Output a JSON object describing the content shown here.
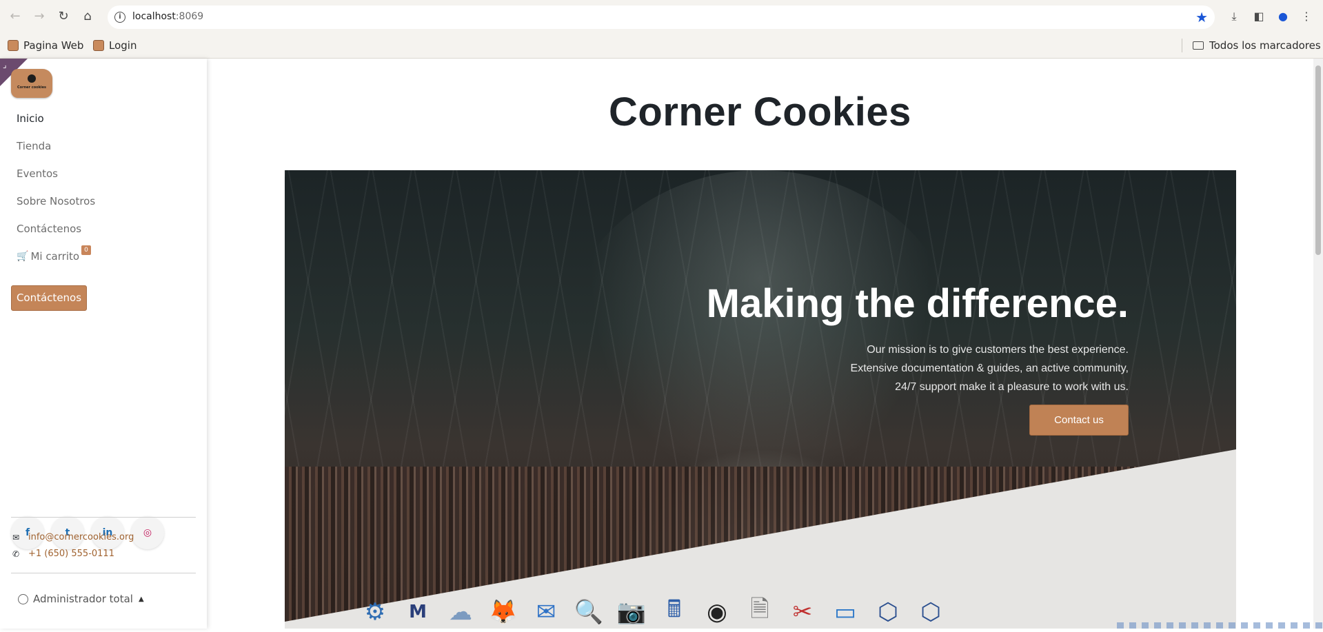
{
  "browser": {
    "url_host": "localhost",
    "url_port": ":8069",
    "bookmarks": [
      {
        "label": "Pagina Web"
      },
      {
        "label": "Login"
      }
    ],
    "all_bookmarks_label": "Todos los marcadores",
    "star_color": "#1a56d6"
  },
  "sidebar": {
    "logo_text": "Corner cookies",
    "menu": [
      {
        "label": "Inicio",
        "active": true
      },
      {
        "label": "Tienda"
      },
      {
        "label": "Eventos"
      },
      {
        "label": "Sobre Nosotros"
      },
      {
        "label": "Contáctenos"
      }
    ],
    "cart_label": "Mi carrito",
    "cart_count": "0",
    "cta_label": "Contáctenos",
    "socials": [
      {
        "name": "facebook-icon",
        "glyph": "f"
      },
      {
        "name": "twitter-icon",
        "glyph": "t"
      },
      {
        "name": "linkedin-icon",
        "glyph": "in"
      },
      {
        "name": "instagram-icon",
        "glyph": "◎"
      }
    ],
    "email": "info@cornercookies.org",
    "phone": "+1 (650) 555-0111",
    "user_label": "Administrador total"
  },
  "main": {
    "title": "Corner Cookies",
    "hero": {
      "heading": "Making the difference.",
      "lines": [
        "Our mission is to give customers the best experience.",
        "Extensive documentation & guides, an active community,",
        "24/7 support make it a pleasure to work with us."
      ],
      "button_label": "Contact us"
    }
  },
  "colors": {
    "accent": "#c48558",
    "text_dark": "#1f2429",
    "link": "#a0622f"
  },
  "dock": [
    {
      "name": "settings-app-icon",
      "glyph": "⚙"
    },
    {
      "name": "max-inside-app-icon",
      "glyph": "M"
    },
    {
      "name": "cloud-app-icon",
      "glyph": "☁"
    },
    {
      "name": "firefox-app-icon",
      "glyph": "🦊"
    },
    {
      "name": "thunderbird-app-icon",
      "glyph": "✉"
    },
    {
      "name": "search-app-icon",
      "glyph": "🔍"
    },
    {
      "name": "camera-app-icon",
      "glyph": "📷"
    },
    {
      "name": "calculator-app-icon",
      "glyph": "🖩"
    },
    {
      "name": "lens-app-icon",
      "glyph": "◉"
    },
    {
      "name": "document-app-icon",
      "glyph": "🗎"
    },
    {
      "name": "scissors-app-icon",
      "glyph": "✂"
    },
    {
      "name": "window-app-icon",
      "glyph": "▭"
    },
    {
      "name": "virtualbox-app-icon",
      "glyph": "⬡"
    },
    {
      "name": "virtualbox-app-icon-2",
      "glyph": "⬡"
    }
  ]
}
